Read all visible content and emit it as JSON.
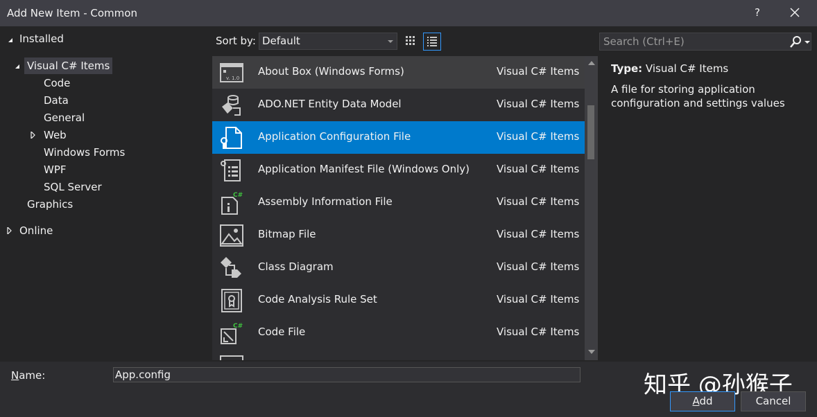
{
  "window": {
    "title": "Add New Item - Common",
    "help_label": "?"
  },
  "tree": {
    "installed": "Installed",
    "visual_csharp_items": "Visual C# Items",
    "children": [
      "Code",
      "Data",
      "General",
      "Web",
      "Windows Forms",
      "WPF",
      "SQL Server"
    ],
    "graphics": "Graphics",
    "online": "Online"
  },
  "toolbar": {
    "sort_label": "Sort by:",
    "sort_value": "Default"
  },
  "items": [
    {
      "name": "About Box (Windows Forms)",
      "category": "Visual C# Items",
      "icon": "about-box-icon"
    },
    {
      "name": "ADO.NET Entity Data Model",
      "category": "Visual C# Items",
      "icon": "entity-model-icon"
    },
    {
      "name": "Application Configuration File",
      "category": "Visual C# Items",
      "icon": "config-file-icon"
    },
    {
      "name": "Application Manifest File (Windows Only)",
      "category": "Visual C# Items",
      "icon": "manifest-icon"
    },
    {
      "name": "Assembly Information File",
      "category": "Visual C# Items",
      "icon": "assembly-info-icon"
    },
    {
      "name": "Bitmap File",
      "category": "Visual C# Items",
      "icon": "bitmap-icon"
    },
    {
      "name": "Class Diagram",
      "category": "Visual C# Items",
      "icon": "class-diagram-icon"
    },
    {
      "name": "Code Analysis Rule Set",
      "category": "Visual C# Items",
      "icon": "rule-set-icon"
    },
    {
      "name": "Code File",
      "category": "Visual C# Items",
      "icon": "code-file-icon"
    }
  ],
  "about_box_version": "v. 1.0",
  "csharp_badge": "C#",
  "search": {
    "placeholder": "Search (Ctrl+E)"
  },
  "details": {
    "type_label": "Type:",
    "type_value": "Visual C# Items",
    "description": "A file for storing application configuration and settings values"
  },
  "footer": {
    "name_label_underlined": "N",
    "name_label_rest": "ame:",
    "name_value": "App.config",
    "add_underlined": "A",
    "add_rest": "dd",
    "cancel_label": "Cancel",
    "watermark": "知乎 @孙猴子"
  },
  "colors": {
    "selected_row": "#007acc",
    "hover_row": "#3e3e40",
    "accent": "#3399ff"
  }
}
